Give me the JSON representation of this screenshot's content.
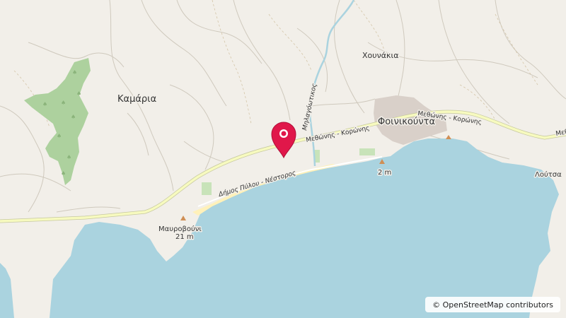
{
  "map": {
    "places": {
      "kamaria": "Καμάρια",
      "chounakia": "Χουνάκια",
      "foinikounta": "Φοινικούντα",
      "loutsa": "Λούτσα"
    },
    "roads": {
      "methonis_koronis_1": "Μεθώνης - Κορώνης",
      "methonis_koronis_2": "Μεθώνης - Κορώνης",
      "edge_label": "Μεθ",
      "coast_label": "Δήμος Πύλου - Νέστορος"
    },
    "river": "Μηλαγόωτικος",
    "peaks": {
      "mavrovouni_name": "Μαυροβούνι",
      "mavrovouni_elev": "21 m",
      "foinikounta_elev": "2 m"
    },
    "attribution": "© OpenStreetMap contributors",
    "colors": {
      "land": "#f2efe9",
      "sea": "#aad3df",
      "forest": "#add19e",
      "beach": "#fff1ba",
      "road": "#f7fabf",
      "marker": "#e0174a"
    },
    "marker_icon": "location-pin-icon"
  }
}
